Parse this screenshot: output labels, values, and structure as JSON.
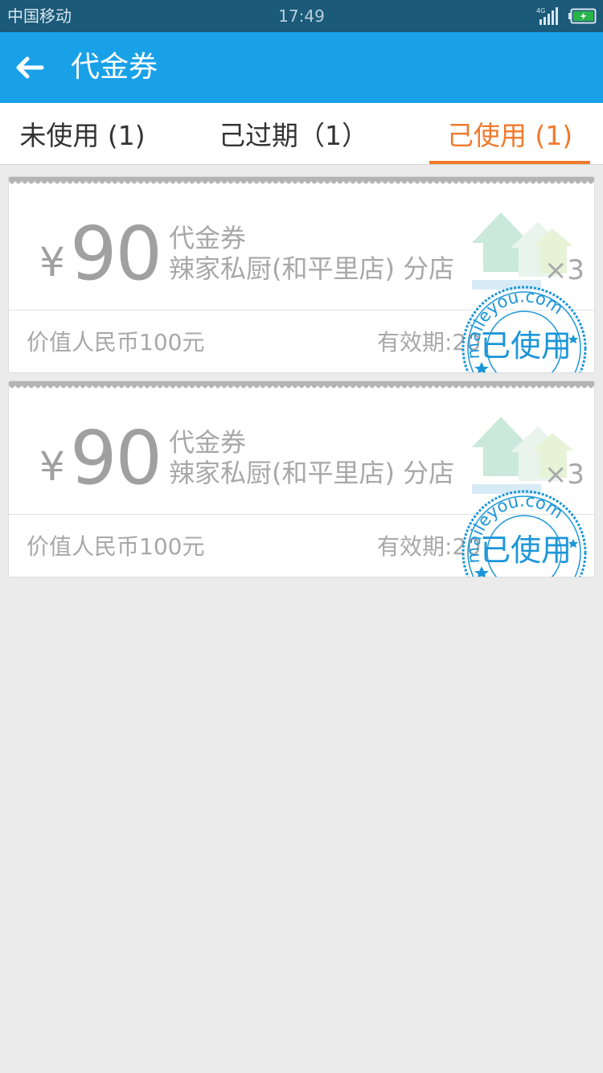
{
  "status_bar": {
    "carrier": "中国移动",
    "time": "17:49",
    "network": "4G"
  },
  "app_bar": {
    "title": "代金券",
    "back_icon": "arrow-left-icon"
  },
  "tabs": [
    {
      "label": "未使用 (1)",
      "active": false
    },
    {
      "label": "己过期（1）",
      "active": false
    },
    {
      "label": "己使用 (1)",
      "active": true
    }
  ],
  "coupons": [
    {
      "currency": "¥",
      "amount": "90",
      "type": "代金券",
      "store": "辣家私厨(和平里店) 分店",
      "quantity": "×3",
      "value_text": "价值人民币100元",
      "expiry_text": "有效期:20",
      "stamp_ring_text": "maileyou.com",
      "stamp_label": "已使用"
    },
    {
      "currency": "¥",
      "amount": "90",
      "type": "代金券",
      "store": "辣家私厨(和平里店) 分店",
      "quantity": "×3",
      "value_text": "价值人民币100元",
      "expiry_text": "有效期:20",
      "stamp_ring_text": "maileyou.com",
      "stamp_label": "已使用"
    }
  ],
  "colors": {
    "status_bar": "#1b5a79",
    "app_bar": "#19a1e8",
    "active_tab": "#f0792c",
    "stamp": "#1c96d9",
    "muted_text": "#a8a8a8",
    "background": "#ebebeb"
  }
}
